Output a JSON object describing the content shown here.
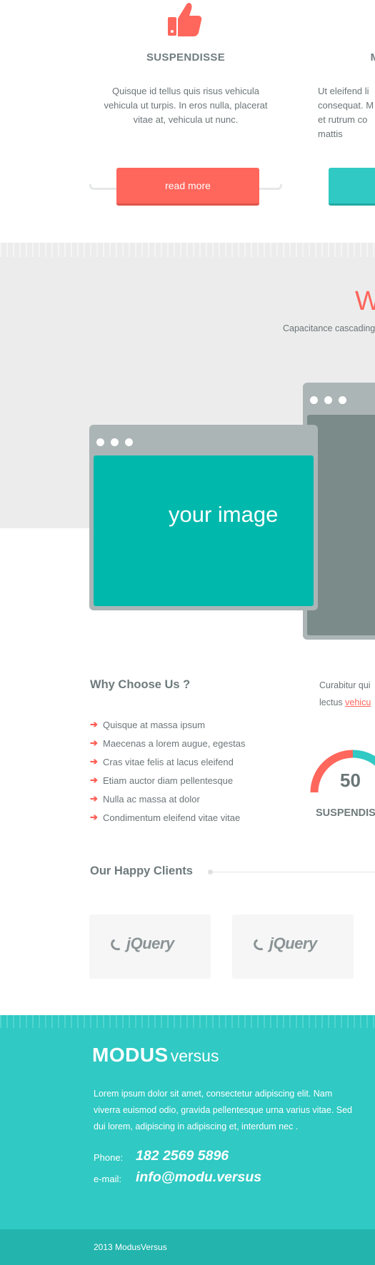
{
  "features": [
    {
      "title": "SUSPENDISSE",
      "text": "Quisque id tellus quis risus vehicula vehicula ut turpis. In eros nulla, placerat vitae at, vehicula ut nunc.",
      "button": "read more",
      "icon": "thumbs-up-icon",
      "color": "#ff665c"
    },
    {
      "title": "M",
      "text": "Ut eleifend li consequat. M et rutrum co mattis",
      "button": "",
      "icon": "",
      "color": "#30c9c3"
    }
  ],
  "showcase": {
    "title": "W",
    "subtitle": "Capacitance cascading",
    "image_label": "your image"
  },
  "why": {
    "title": "Why Choose Us ?",
    "items": [
      "Quisque at massa ipsum",
      "Maecenas a lorem augue, egestas",
      "Cras vitae felis at lacus eleifend",
      "Etiam auctor diam pellentesque",
      "Nulla ac massa at dolor",
      "Condimentum eleifend vitae vitae"
    ],
    "side_text_line1": "Curabitur qui",
    "side_text_line2": "lectus",
    "side_link": "vehicu",
    "gauge_value": "50",
    "gauge_label": "SUSPENDIS"
  },
  "clients": {
    "title": "Our Happy Clients",
    "logos": [
      "jQuery",
      "jQuery"
    ]
  },
  "footer": {
    "brand_bold": "MODUS",
    "brand_light": "versus",
    "text": "Lorem ipsum dolor sit amet, consectetur adipiscing elit. Nam viverra euismod odio, gravida pellentesque urna varius vitae. Sed dui lorem, adipiscing in adipiscing et, interdum nec .",
    "phone_label": "Phone:",
    "phone": "182 2569 5896",
    "email_label": "e-mail:",
    "email": "info@modu.versus",
    "copyright": "2013  ModusVersus"
  },
  "colors": {
    "accent": "#ff665c",
    "teal": "#30c9c3",
    "gray_bg": "#ececec"
  }
}
